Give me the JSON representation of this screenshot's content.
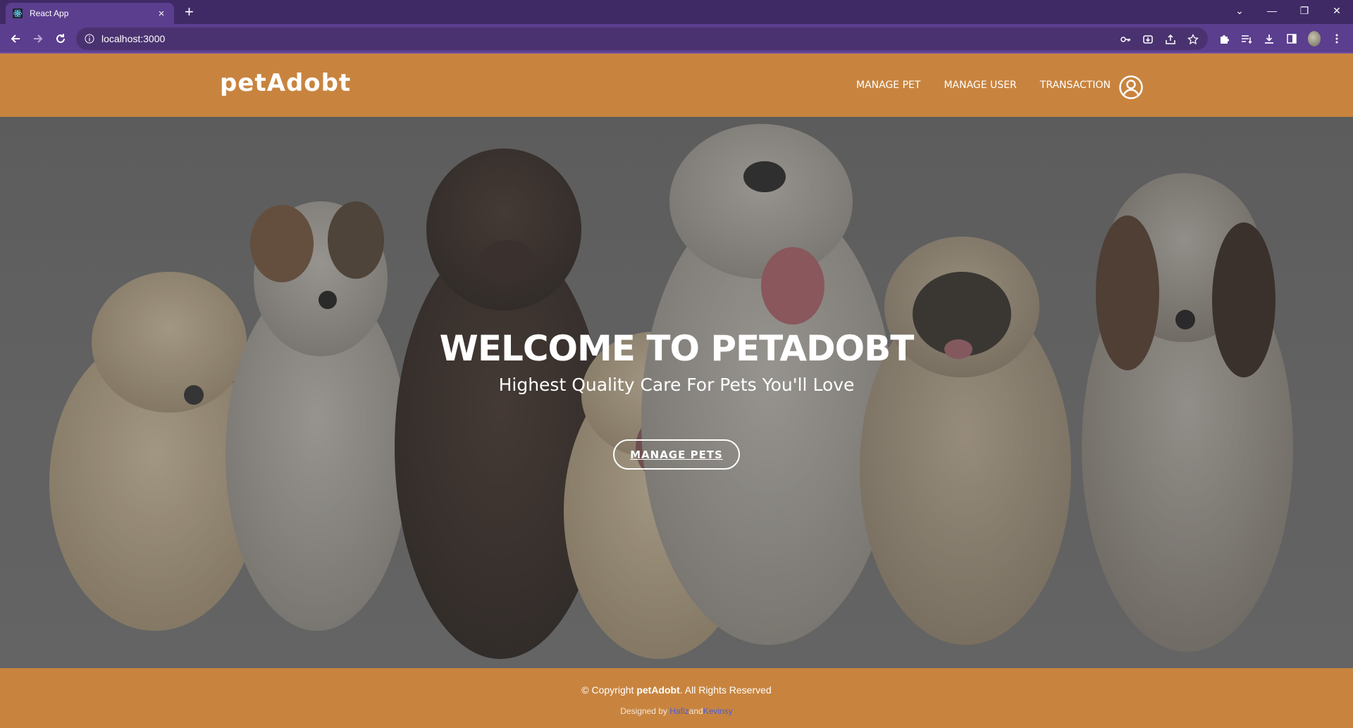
{
  "browser": {
    "tab_title": "React App",
    "tab_close": "×",
    "new_tab": "+",
    "url": "localhost:3000",
    "window_controls": [
      "⌄",
      "—",
      "❐",
      "✕"
    ]
  },
  "nav": {
    "brand": "petAdobt",
    "links": [
      "MANAGE PET",
      "MANAGE USER",
      "TRANSACTION"
    ]
  },
  "hero": {
    "title": "WELCOME TO PETADOBT",
    "subtitle": "Highest Quality Care For Pets You'll Love",
    "button": "MANAGE PETS"
  },
  "footer": {
    "copyright_prefix": "© Copyright ",
    "copyright_brand": "petAdobt",
    "copyright_suffix": ". All Rights Reserved",
    "designed_by": "Designed by ",
    "author1": "Hafiz",
    "and": "and",
    "author2": "Kevinsy"
  },
  "colors": {
    "browser_frame": "#3f2a66",
    "browser_toolbar": "#5b3e8e",
    "brand_orange": "#c8843f",
    "hero_overlay": "#666666"
  }
}
